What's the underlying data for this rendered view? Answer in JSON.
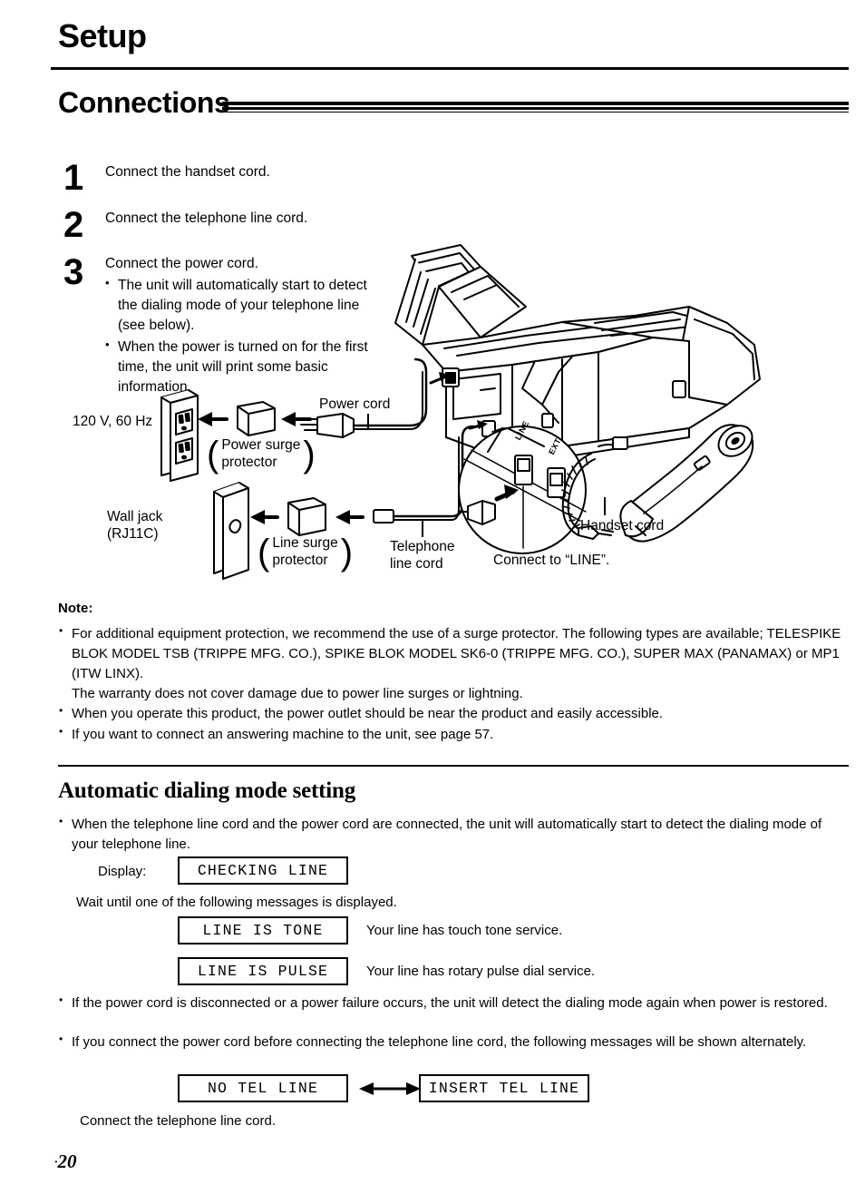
{
  "page": {
    "chapter_title": "Setup",
    "section_title": "Connections",
    "page_number": "20"
  },
  "steps": [
    {
      "number": "1",
      "text": "Connect the handset cord."
    },
    {
      "number": "2",
      "text": "Connect the telephone line cord."
    },
    {
      "number": "3",
      "text": "Connect the power cord."
    }
  ],
  "step3_bullets": [
    "The unit will automatically start to detect the dialing mode of your telephone line (see below).",
    "When the power is turned on for the first time, the unit will print some basic information."
  ],
  "diagram": {
    "labels": {
      "voltage": "120 V, 60 Hz",
      "power_cord": "Power cord",
      "power_surge_protector_line1": "Power surge",
      "power_surge_protector_line2": "protector",
      "wall_jack_line1": "Wall jack",
      "wall_jack_line2": "(RJ11C)",
      "line_surge_protector_line1": "Line surge",
      "line_surge_protector_line2": "protector",
      "telephone_line_cord_line1": "Telephone",
      "telephone_line_cord_line2": "line cord",
      "connect_to_line": "Connect to “LINE”.",
      "handset_cord": "Handset cord",
      "jack_line": "LINE",
      "jack_ext": "EXT"
    }
  },
  "note": {
    "heading": "Note:",
    "items": [
      "For additional equipment protection, we recommend the use of a surge protector. The following types are available; TELESPIKE BLOK MODEL TSB (TRIPPE MFG. CO.), SPIKE BLOK MODEL SK6-0 (TRIPPE MFG. CO.), SUPER MAX (PANAMAX) or MP1 (ITW LINX).",
      "When you operate this product, the power outlet should be near the product and easily accessible.",
      "If you want to connect an answering machine to the unit, see page 57."
    ],
    "warranty_line": "The warranty does not cover damage due to power line surges or lightning."
  },
  "auto_dialing": {
    "heading": "Automatic dialing mode setting",
    "intro_bullet": "When the telephone line cord and the power cord are connected, the unit will automatically start to detect the dialing mode of your telephone line.",
    "display_label": "Display:",
    "display_value": "CHECKING LINE",
    "wait_line": "Wait until one of the following messages is displayed.",
    "messages": [
      {
        "display": "LINE IS TONE",
        "description": "Your line has touch tone service."
      },
      {
        "display": "LINE IS PULSE",
        "description": "Your line has rotary pulse dial service."
      }
    ],
    "bullets": [
      "If the power cord is disconnected or a power failure occurs, the unit will detect the dialing mode again when power is restored.",
      "If you connect the power cord before connecting the telephone line cord, the following messages will be shown alternately."
    ],
    "alternating": {
      "left": "NO TEL LINE",
      "right": "INSERT TEL LINE"
    },
    "closing_line": "Connect the telephone line cord."
  }
}
